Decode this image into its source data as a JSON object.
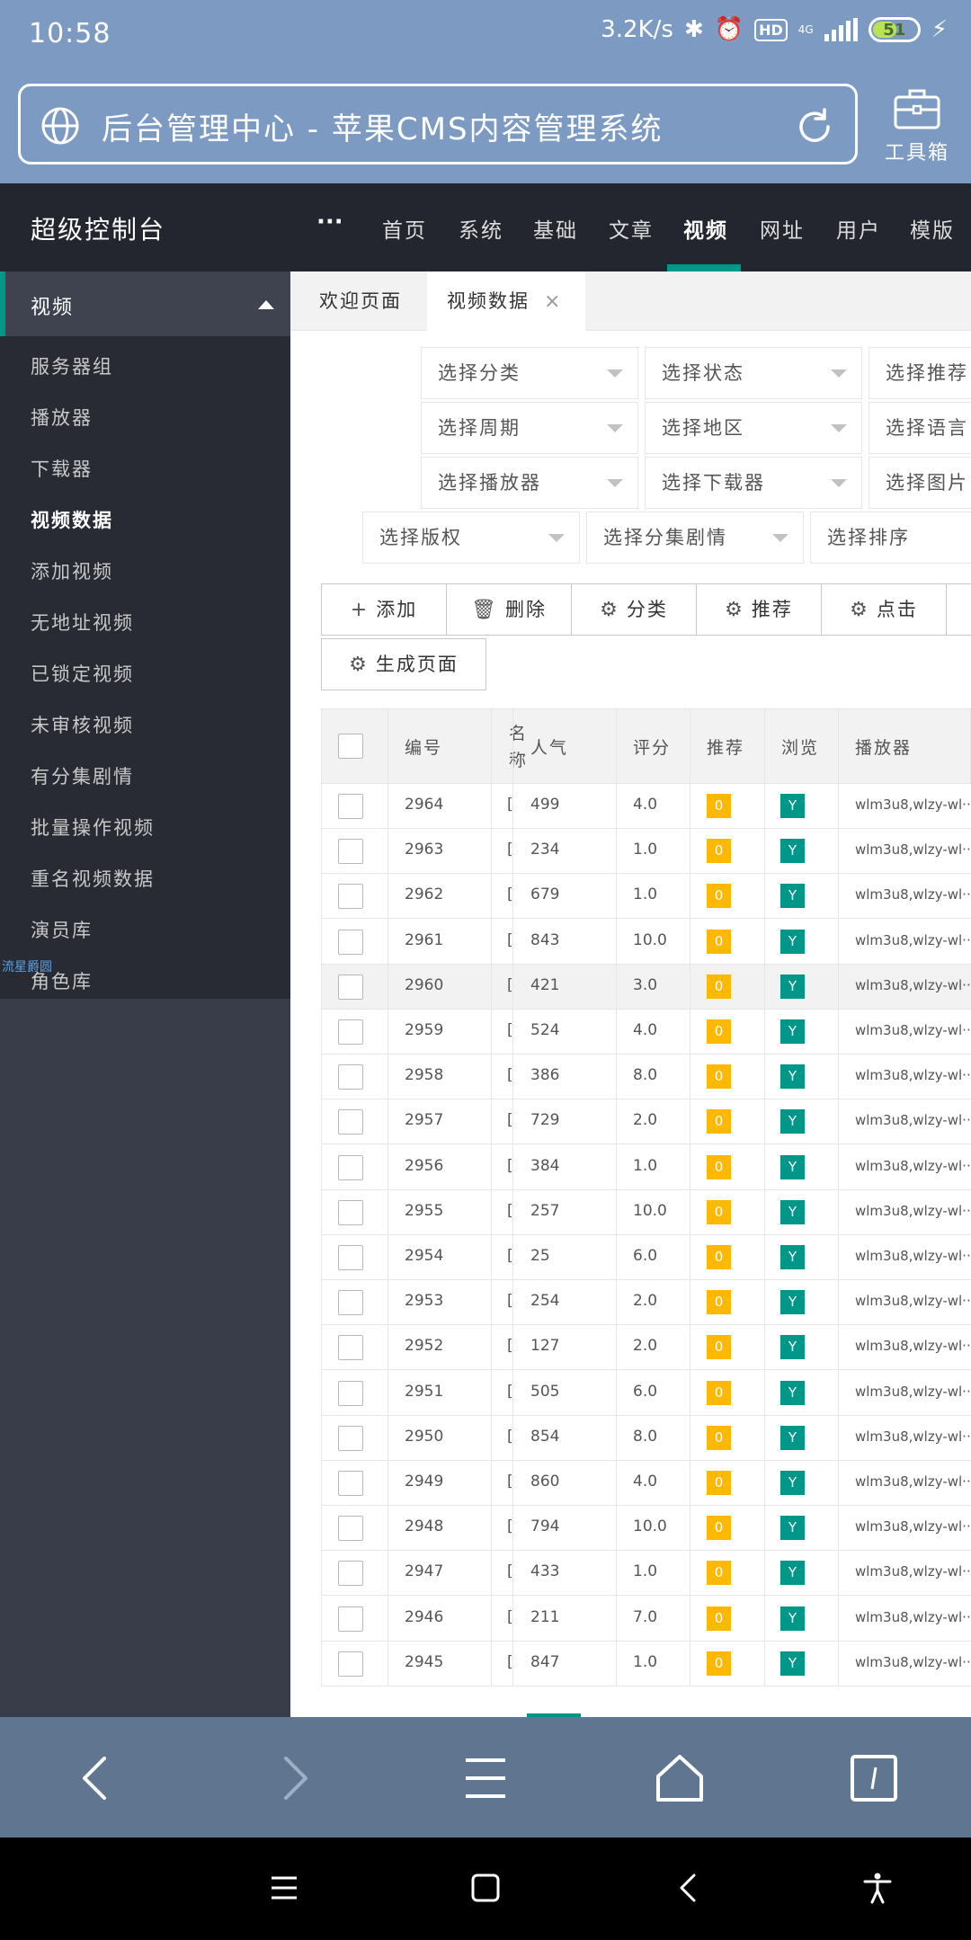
{
  "status_bar": {
    "time": "10:58",
    "net_speed": "3.2K/s",
    "network_type": "4G",
    "battery": "51",
    "battery_level": 0.51,
    "hd": "HD"
  },
  "browser": {
    "page_title": "后台管理中心 - 苹果CMS内容管理系统",
    "toolbox_label": "工具箱"
  },
  "header": {
    "brand": "超级控制台",
    "more": "···",
    "nav": [
      "首页",
      "系统",
      "基础",
      "文章",
      "视频",
      "网址",
      "用户",
      "模版"
    ],
    "active_nav": "视频"
  },
  "sidebar": {
    "section": "视频",
    "items": [
      "服务器组",
      "播放器",
      "下载器",
      "视频数据",
      "添加视频",
      "无地址视频",
      "已锁定视频",
      "未审核视频",
      "有分集剧情",
      "批量操作视频",
      "重名视频数据",
      "演员库",
      "角色库"
    ],
    "active": "视频数据",
    "watermark": "流星爵圆"
  },
  "tabs": [
    {
      "label": "欢迎页面"
    },
    {
      "label": "视频数据",
      "close": "×"
    }
  ],
  "filters": [
    [
      "选择分类",
      "选择状态",
      "选择推荐"
    ],
    [
      "选择周期",
      "选择地区",
      "选择语言"
    ],
    [
      "选择播放器",
      "选择下载器",
      "选择图片"
    ],
    [
      "选择版权",
      "选择分集剧情",
      "选择排序"
    ]
  ],
  "toolbar": {
    "add": "添加",
    "delete": "删除",
    "category": "分类",
    "recommend": "推荐",
    "hits": "点击",
    "generate": "生成页面"
  },
  "table": {
    "headers": {
      "id": "编号",
      "name_1": "名",
      "name_2": "称",
      "popularity": "人气",
      "score": "评分",
      "recommend": "推荐",
      "view": "浏览",
      "player": "播放器"
    },
    "rows": [
      {
        "id": "2964",
        "name": "[",
        "pop": "499",
        "score": "4.0",
        "rec": "0",
        "view": "Y",
        "player": "wlm3u8,wlzy-wl···"
      },
      {
        "id": "2963",
        "name": "[",
        "pop": "234",
        "score": "1.0",
        "rec": "0",
        "view": "Y",
        "player": "wlm3u8,wlzy-wl···"
      },
      {
        "id": "2962",
        "name": "[",
        "pop": "679",
        "score": "1.0",
        "rec": "0",
        "view": "Y",
        "player": "wlm3u8,wlzy-wl···"
      },
      {
        "id": "2961",
        "name": "[",
        "pop": "843",
        "score": "10.0",
        "rec": "0",
        "view": "Y",
        "player": "wlm3u8,wlzy-wl···"
      },
      {
        "id": "2960",
        "name": "[",
        "pop": "421",
        "score": "3.0",
        "rec": "0",
        "view": "Y",
        "player": "wlm3u8,wlzy-wl···"
      },
      {
        "id": "2959",
        "name": "[",
        "pop": "524",
        "score": "4.0",
        "rec": "0",
        "view": "Y",
        "player": "wlm3u8,wlzy-wl···"
      },
      {
        "id": "2958",
        "name": "[",
        "pop": "386",
        "score": "8.0",
        "rec": "0",
        "view": "Y",
        "player": "wlm3u8,wlzy-wl···"
      },
      {
        "id": "2957",
        "name": "[",
        "pop": "729",
        "score": "2.0",
        "rec": "0",
        "view": "Y",
        "player": "wlm3u8,wlzy-wl···"
      },
      {
        "id": "2956",
        "name": "[",
        "pop": "384",
        "score": "1.0",
        "rec": "0",
        "view": "Y",
        "player": "wlm3u8,wlzy-wl···"
      },
      {
        "id": "2955",
        "name": "[",
        "pop": "257",
        "score": "10.0",
        "rec": "0",
        "view": "Y",
        "player": "wlm3u8,wlzy-wl···"
      },
      {
        "id": "2954",
        "name": "[",
        "pop": "25",
        "score": "6.0",
        "rec": "0",
        "view": "Y",
        "player": "wlm3u8,wlzy-wl···"
      },
      {
        "id": "2953",
        "name": "[",
        "pop": "254",
        "score": "2.0",
        "rec": "0",
        "view": "Y",
        "player": "wlm3u8,wlzy-wl···"
      },
      {
        "id": "2952",
        "name": "[",
        "pop": "127",
        "score": "2.0",
        "rec": "0",
        "view": "Y",
        "player": "wlm3u8,wlzy-wl···"
      },
      {
        "id": "2951",
        "name": "[",
        "pop": "505",
        "score": "6.0",
        "rec": "0",
        "view": "Y",
        "player": "wlm3u8,wlzy-wl···"
      },
      {
        "id": "2950",
        "name": "[",
        "pop": "854",
        "score": "8.0",
        "rec": "0",
        "view": "Y",
        "player": "wlm3u8,wlzy-wl···"
      },
      {
        "id": "2949",
        "name": "[",
        "pop": "860",
        "score": "4.0",
        "rec": "0",
        "view": "Y",
        "player": "wlm3u8,wlzy-wl···"
      },
      {
        "id": "2948",
        "name": "[",
        "pop": "794",
        "score": "10.0",
        "rec": "0",
        "view": "Y",
        "player": "wlm3u8,wlzy-wl···"
      },
      {
        "id": "2947",
        "name": "[",
        "pop": "433",
        "score": "1.0",
        "rec": "0",
        "view": "Y",
        "player": "wlm3u8,wlzy-wl···"
      },
      {
        "id": "2946",
        "name": "[",
        "pop": "211",
        "score": "7.0",
        "rec": "0",
        "view": "Y",
        "player": "wlm3u8,wlzy-wl···"
      },
      {
        "id": "2945",
        "name": "[",
        "pop": "847",
        "score": "1.0",
        "rec": "0",
        "view": "Y",
        "player": "wlm3u8,wlzy-wl···"
      }
    ],
    "hover_row": "2960"
  },
  "colors": {
    "accent": "#009688",
    "warning": "#ffb800",
    "sidebar_bg": "#282b33",
    "header_bg": "#23262e",
    "browser_bar": "#7d9bc2"
  }
}
